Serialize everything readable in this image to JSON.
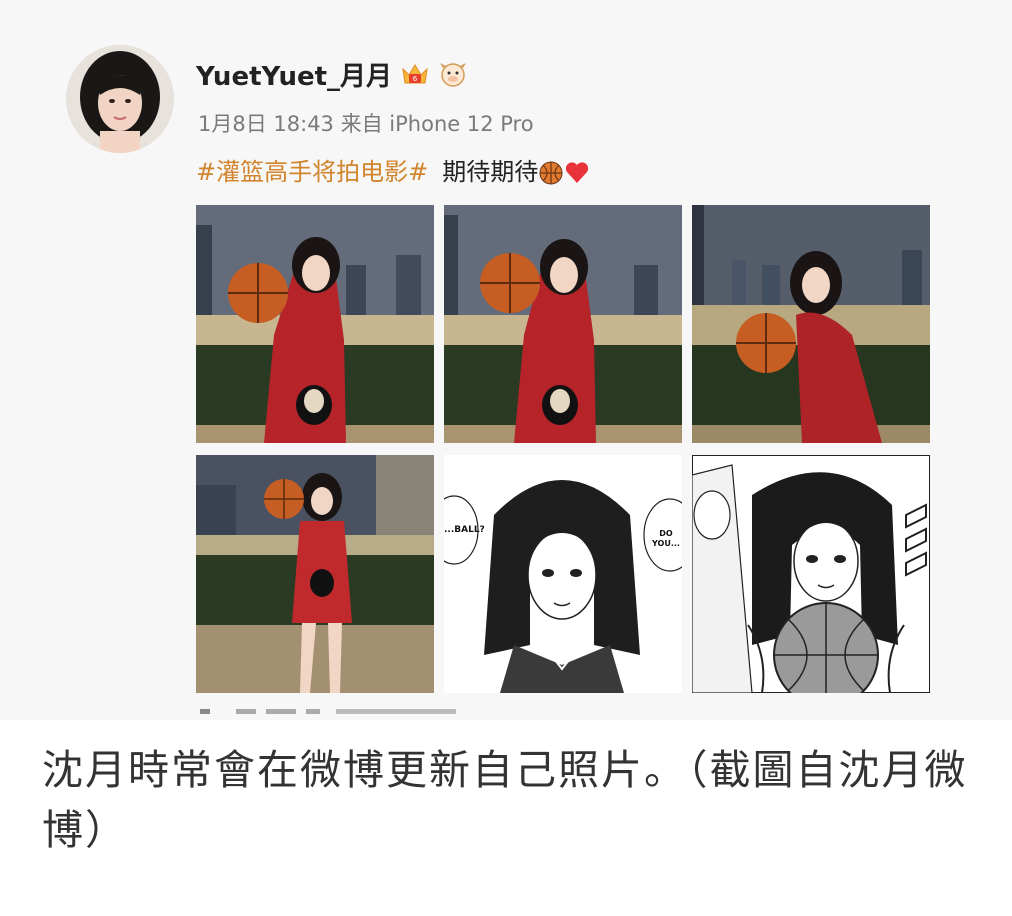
{
  "post": {
    "username": "YuetYuet_月月",
    "badges": [
      "vip-crown-icon",
      "cow-face-icon"
    ],
    "timestamp": "1月8日 18:43",
    "source_prefix": "来自",
    "source_device": "iPhone 12 Pro",
    "hashtag": "#灌篮高手将拍电影#",
    "text": "期待期待",
    "text_emojis": [
      "basketball-icon",
      "heart-icon"
    ],
    "images": [
      {
        "kind": "photo",
        "label": "basketball-photo-1"
      },
      {
        "kind": "photo",
        "label": "basketball-photo-2"
      },
      {
        "kind": "photo",
        "label": "basketball-photo-3"
      },
      {
        "kind": "photo",
        "label": "basketball-photo-4"
      },
      {
        "kind": "manga",
        "label": "manga-panel-1",
        "bubble_left": "...BALL?",
        "bubble_right": "DO YOU..."
      },
      {
        "kind": "manga",
        "label": "manga-panel-2"
      }
    ]
  },
  "caption": "沈月時常會在微博更新自己照片。（截圖自沈月微博）",
  "colors": {
    "hashtag": "#d1842b",
    "username": "#222222",
    "meta": "#7a7a7a",
    "caption": "#333333",
    "post_bg": "#f7f7f7"
  }
}
